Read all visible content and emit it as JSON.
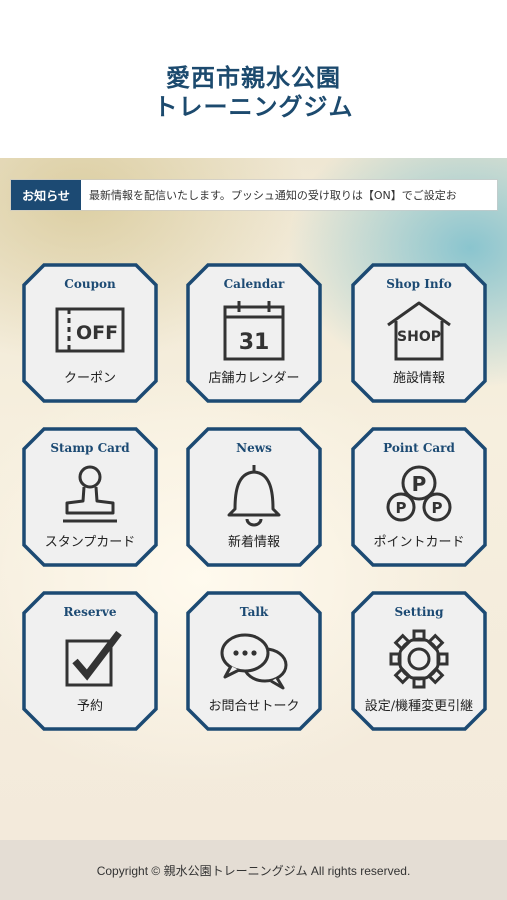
{
  "header": {
    "title_line1": "愛西市親水公園",
    "title_line2": "トレーニングジム"
  },
  "notice": {
    "badge": "お知らせ",
    "text": "最新情報を配信いたします。プッシュ通知の受け取りは【ON】でご設定お"
  },
  "tiles": [
    {
      "en": "Coupon",
      "ja": "クーポン",
      "icon": "coupon-icon",
      "icon_text": "OFF"
    },
    {
      "en": "Calendar",
      "ja": "店舗カレンダー",
      "icon": "calendar-icon",
      "icon_text": "31"
    },
    {
      "en": "Shop Info",
      "ja": "施設情報",
      "icon": "shop-icon",
      "icon_text": "SHOP"
    },
    {
      "en": "Stamp Card",
      "ja": "スタンプカード",
      "icon": "stamp-icon"
    },
    {
      "en": "News",
      "ja": "新着情報",
      "icon": "bell-icon"
    },
    {
      "en": "Point Card",
      "ja": "ポイントカード",
      "icon": "point-card-icon",
      "icon_text": "P"
    },
    {
      "en": "Reserve",
      "ja": "予約",
      "icon": "checkbox-icon"
    },
    {
      "en": "Talk",
      "ja": "お問合せトーク",
      "icon": "chat-bubbles-icon"
    },
    {
      "en": "Setting",
      "ja": "設定/機種変更引継",
      "icon": "gear-icon"
    }
  ],
  "footer": {
    "copyright": "Copyright © 親水公園トレーニングジム All rights reserved."
  },
  "colors": {
    "accent": "#1c4a73",
    "tile_fill": "#f0f0f0"
  }
}
